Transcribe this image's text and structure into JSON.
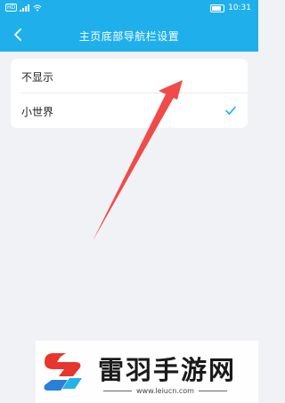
{
  "status_bar": {
    "left_text": "HD",
    "time": "10:31",
    "signal_icon": "signal-icon",
    "wifi_icon": "wifi-icon",
    "battery_icon": "battery-icon"
  },
  "header": {
    "title": "主页底部导航栏设置",
    "back_icon": "back-arrow-icon",
    "background_color": "#1fb0ec"
  },
  "options": [
    {
      "label": "不显示",
      "selected": false
    },
    {
      "label": "小世界",
      "selected": true
    }
  ],
  "check_icon": "check-icon",
  "accent_color": "#1fb0ec",
  "annotation_arrow_color": "#f04a4a",
  "watermark": {
    "name": "雷羽手游网",
    "url": "www.leiucn.com"
  }
}
